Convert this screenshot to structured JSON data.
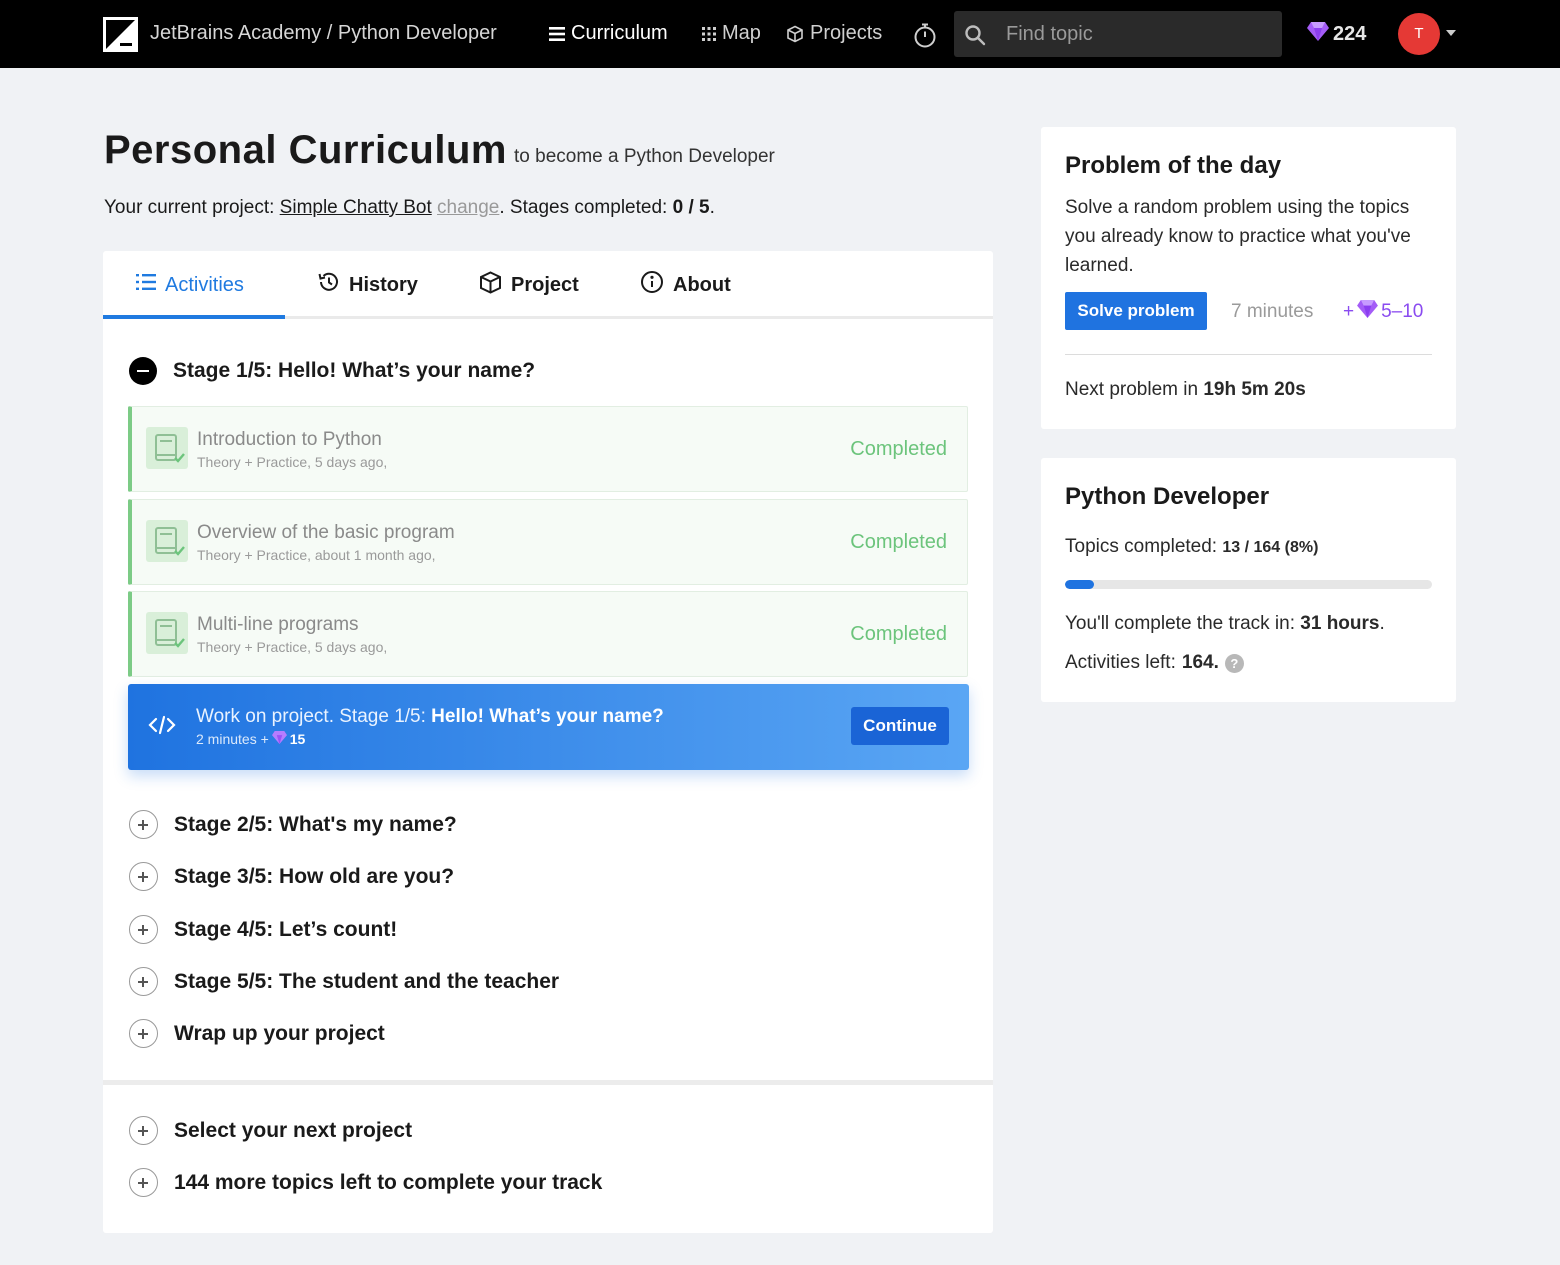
{
  "nav": {
    "brand": "JetBrains Academy / Python Developer",
    "items": [
      {
        "label": "Curriculum",
        "icon": "list-icon",
        "active": true
      },
      {
        "label": "Map",
        "icon": "grid-icon",
        "active": false
      },
      {
        "label": "Projects",
        "icon": "cube-icon",
        "active": false
      }
    ],
    "search_placeholder": "Find topic",
    "gems": "224",
    "avatar_initial": "T"
  },
  "header": {
    "title": "Personal Curriculum",
    "subtitle": "to become a Python Developer",
    "project_prefix": "Your current project:",
    "project_name": "Simple Chatty Bot",
    "change_label": "change",
    "stages_prefix": ". Stages completed:",
    "stages_value": "0 / 5",
    "stages_suffix": "."
  },
  "tabs": [
    {
      "label": "Activities",
      "icon": "list-icon",
      "active": true
    },
    {
      "label": "History",
      "icon": "history-icon",
      "active": false
    },
    {
      "label": "Project",
      "icon": "cube-icon",
      "active": false
    },
    {
      "label": "About",
      "icon": "info-icon",
      "active": false
    }
  ],
  "current_stage": {
    "title": "Stage 1/5: Hello! What’s your name?",
    "topics": [
      {
        "name": "Introduction to Python",
        "meta": "Theory + Practice, 5 days ago,",
        "status": "Completed"
      },
      {
        "name": "Overview of the basic program",
        "meta": "Theory + Practice, about 1 month ago,",
        "status": "Completed"
      },
      {
        "name": "Multi-line programs",
        "meta": "Theory + Practice, 5 days ago,",
        "status": "Completed"
      }
    ],
    "project_task": {
      "prefix": "Work on project. Stage 1/5: ",
      "title": "Hello! What’s your name?",
      "time": "2 minutes +",
      "gems": "15",
      "button": "Continue"
    }
  },
  "other_stages": [
    "Stage 2/5: What's my name?",
    "Stage 3/5: How old are you?",
    "Stage 4/5: Let’s count!",
    "Stage 5/5: The student and the teacher",
    "Wrap up your project"
  ],
  "extra_items": [
    "Select your next project",
    "144 more topics left to complete your track"
  ],
  "problem_of_the_day": {
    "title": "Problem of the day",
    "description": "Solve a random problem using the topics you already know to practice what you've learned.",
    "button": "Solve problem",
    "time": "7 minutes",
    "gems_prefix": "+",
    "gems": "5–10",
    "next_prefix": "Next problem in",
    "next_value": "19h 5m 20s"
  },
  "track": {
    "title": "Python Developer",
    "topics_prefix": "Topics completed:",
    "topics_value": "13 / 164 (8%)",
    "progress_percent": 8,
    "complete_prefix": "You'll complete the track in:",
    "complete_value": "31 hours",
    "complete_suffix": ".",
    "activities_prefix": "Activities left:",
    "activities_value": "164."
  },
  "colors": {
    "accent": "#1f73e0",
    "completed": "#6cc47c",
    "gem": "#8a4bf0",
    "avatar": "#e53935"
  }
}
